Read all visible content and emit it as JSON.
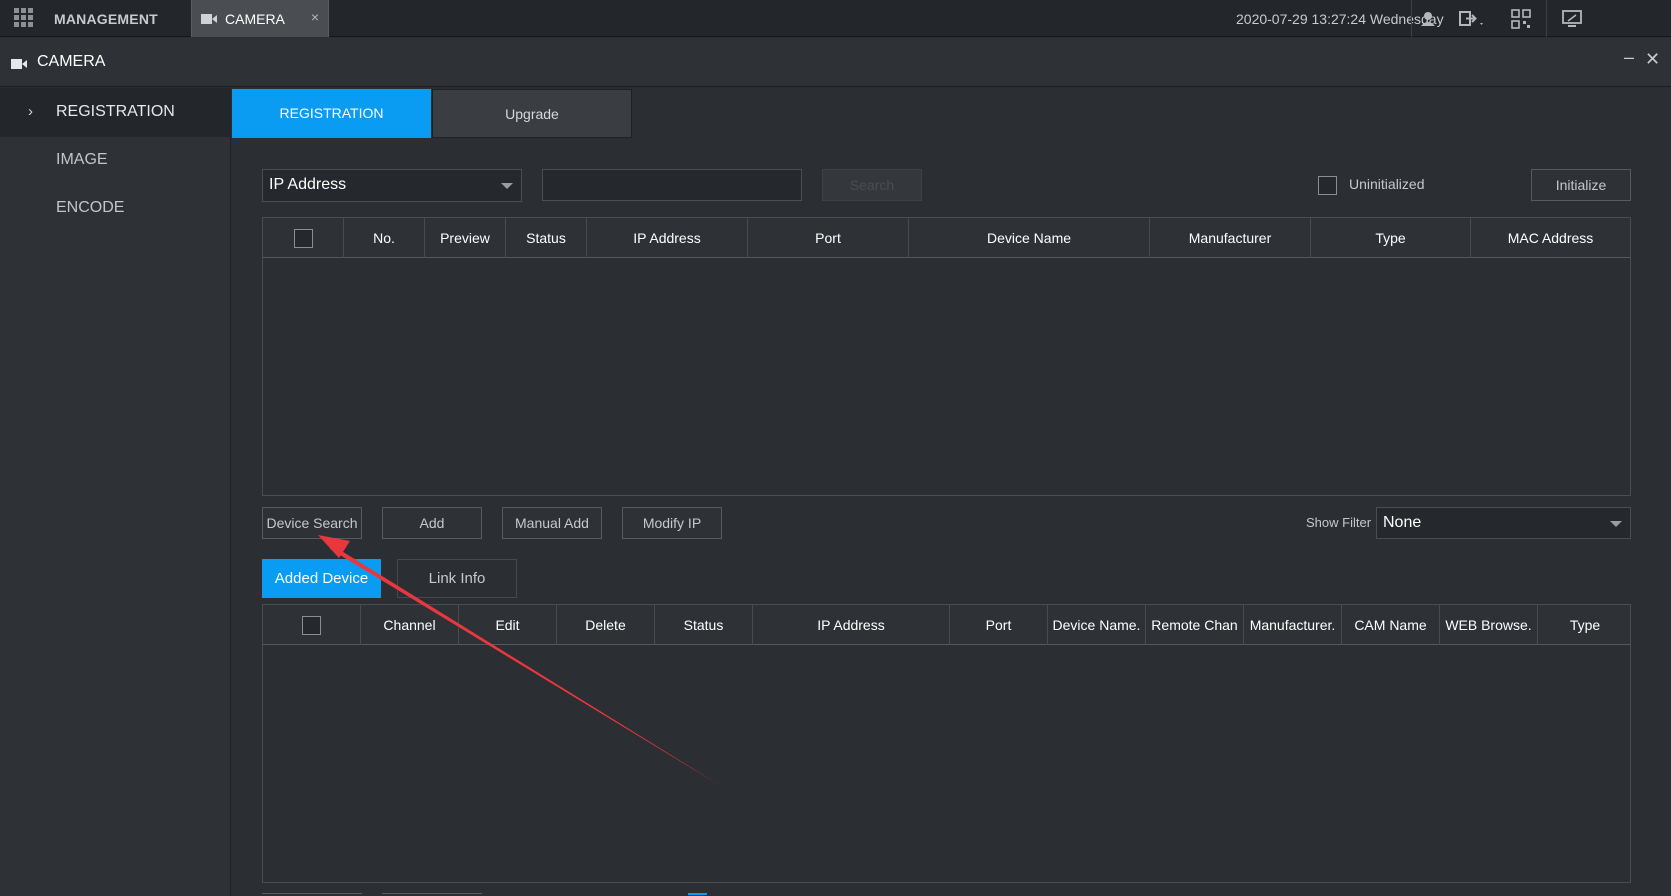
{
  "topbar": {
    "management_label": "MANAGEMENT",
    "tab_label": "CAMERA",
    "tab_close": "×",
    "datetime": "2020-07-29 13:27:24 Wednesday",
    "icons": [
      "grid-icon",
      "camera-icon",
      "user-icon",
      "logout-icon",
      "qrcode-icon",
      "monitor-icon"
    ]
  },
  "window": {
    "title": "CAMERA",
    "minimize": "–",
    "close": "✕"
  },
  "sidebar": {
    "items": [
      {
        "label": "REGISTRATION",
        "active": true,
        "chevron": "›"
      },
      {
        "label": "IMAGE",
        "active": false
      },
      {
        "label": "ENCODE",
        "active": false
      }
    ]
  },
  "tabs": {
    "registration": "REGISTRATION",
    "upgrade": "Upgrade"
  },
  "filter": {
    "type_value": "IP Address",
    "search_text": "",
    "search_button": "Search",
    "uninitialized_label": "Uninitialized",
    "initialize_button": "Initialize"
  },
  "search_table": {
    "columns": [
      "No.",
      "Preview",
      "Status",
      "IP Address",
      "Port",
      "Device Name",
      "Manufacturer",
      "Type",
      "MAC Address"
    ],
    "rows": []
  },
  "actions": {
    "device_search": "Device Search",
    "add": "Add",
    "manual_add": "Manual Add",
    "modify_ip": "Modify IP",
    "show_filter_label": "Show Filter",
    "show_filter_value": "None"
  },
  "lower_tabs": {
    "added_device": "Added Device",
    "link_info": "Link Info"
  },
  "added_table": {
    "columns": [
      "Channel",
      "Edit",
      "Delete",
      "Status",
      "IP Address",
      "Port",
      "Device Name.",
      "Remote Chan",
      "Manufacturer.",
      "CAM Name",
      "WEB Browse.",
      "Type"
    ],
    "rows": []
  },
  "colors": {
    "accent": "#0a9cf2",
    "annotation_arrow": "#e8383d"
  }
}
